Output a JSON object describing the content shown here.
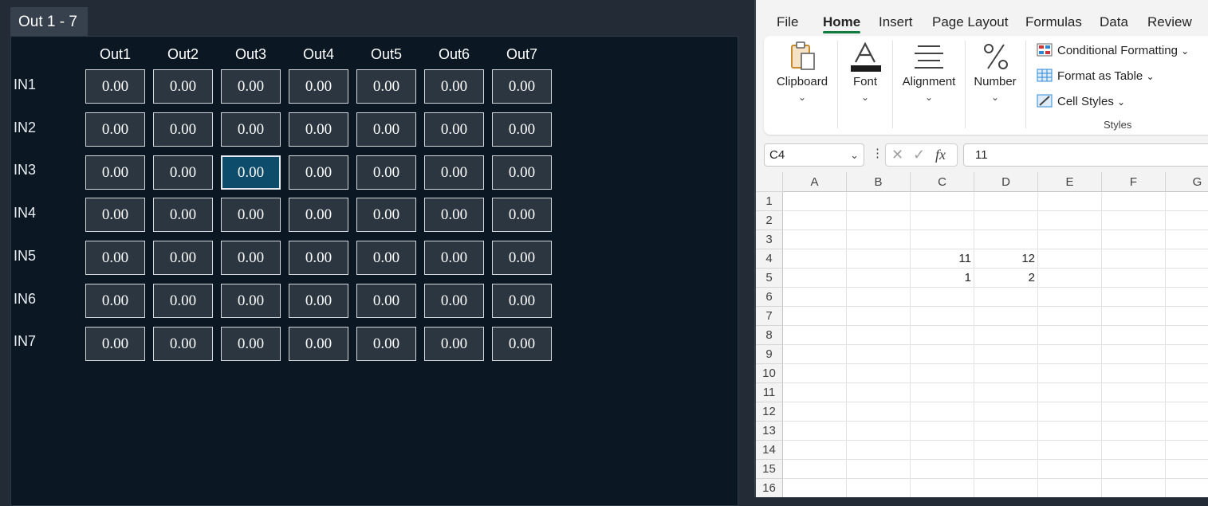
{
  "matrix": {
    "tab_label": "Out 1 - 7",
    "columns": [
      "Out1",
      "Out2",
      "Out3",
      "Out4",
      "Out5",
      "Out6",
      "Out7"
    ],
    "rows": [
      {
        "label": "IN1",
        "values": [
          "0.00",
          "0.00",
          "0.00",
          "0.00",
          "0.00",
          "0.00",
          "0.00"
        ]
      },
      {
        "label": "IN2",
        "values": [
          "0.00",
          "0.00",
          "0.00",
          "0.00",
          "0.00",
          "0.00",
          "0.00"
        ]
      },
      {
        "label": "IN3",
        "values": [
          "0.00",
          "0.00",
          "0.00",
          "0.00",
          "0.00",
          "0.00",
          "0.00"
        ]
      },
      {
        "label": "IN4",
        "values": [
          "0.00",
          "0.00",
          "0.00",
          "0.00",
          "0.00",
          "0.00",
          "0.00"
        ]
      },
      {
        "label": "IN5",
        "values": [
          "0.00",
          "0.00",
          "0.00",
          "0.00",
          "0.00",
          "0.00",
          "0.00"
        ]
      },
      {
        "label": "IN6",
        "values": [
          "0.00",
          "0.00",
          "0.00",
          "0.00",
          "0.00",
          "0.00",
          "0.00"
        ]
      },
      {
        "label": "IN7",
        "values": [
          "0.00",
          "0.00",
          "0.00",
          "0.00",
          "0.00",
          "0.00",
          "0.00"
        ]
      }
    ],
    "selected_cell": {
      "row": "IN3",
      "column": "Out3"
    },
    "colors": {
      "selected": "#0e4c6b",
      "cell": "#2b3640",
      "panel": "#0b1824"
    }
  },
  "excel": {
    "menu": [
      "File",
      "Home",
      "Insert",
      "Page Layout",
      "Formulas",
      "Data",
      "Review"
    ],
    "active_menu": "Home",
    "ribbon": {
      "groups": [
        {
          "label": "Clipboard",
          "icon": "clipboard-icon"
        },
        {
          "label": "Font",
          "icon": "font-color-icon"
        },
        {
          "label": "Alignment",
          "icon": "align-icon"
        },
        {
          "label": "Number",
          "icon": "percent-icon"
        }
      ],
      "styles": {
        "items": [
          "Conditional Formatting",
          "Format as Table",
          "Cell Styles"
        ],
        "label": "Styles"
      }
    },
    "name_box": "C4",
    "formula_value": "11",
    "fx_label": "fx",
    "column_headers": [
      "A",
      "B",
      "C",
      "D",
      "E",
      "F",
      "G"
    ],
    "row_headers": [
      "1",
      "2",
      "3",
      "4",
      "5",
      "6",
      "7",
      "8",
      "9",
      "10",
      "11",
      "12",
      "13",
      "14",
      "15",
      "16"
    ],
    "cells": [
      {
        "ref": "C4",
        "value": "11"
      },
      {
        "ref": "D4",
        "value": "12"
      },
      {
        "ref": "C5",
        "value": "1"
      },
      {
        "ref": "D5",
        "value": "2"
      }
    ],
    "accent_color": "#107c41"
  }
}
